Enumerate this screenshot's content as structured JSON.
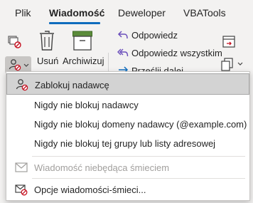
{
  "tabs": [
    {
      "label": "Plik"
    },
    {
      "label": "Wiadomość",
      "active": true
    },
    {
      "label": "Deweloper"
    },
    {
      "label": "VBATools"
    }
  ],
  "ribbon": {
    "delete_label": "Usuń",
    "archive_label": "Archiwizuj",
    "reply_label": "Odpowiedz",
    "reply_all_label": "Odpowiedz wszystkim",
    "forward_label": "Prześlij dalej"
  },
  "menu": {
    "items": [
      {
        "label": "Zablokuj nadawcę",
        "icon": "block-sender-icon",
        "highlighted": true
      },
      {
        "label": "Nigdy nie blokuj nadawcy"
      },
      {
        "label": "Nigdy nie blokuj domeny nadawcy (@example.com)"
      },
      {
        "label": "Nigdy nie blokuj tej grupy lub listy adresowej"
      },
      {
        "label": "Wiadomość niebędąca śmieciem",
        "icon": "mail-icon",
        "disabled": true
      },
      {
        "label": "Opcje wiadomości-śmieci...",
        "icon": "junk-options-icon"
      }
    ]
  },
  "colors": {
    "accent": "#0f6cbd",
    "reply_arrow": "#6b4fbb",
    "block_red": "#c50f1f",
    "archive_green": "#5b8c3a"
  }
}
